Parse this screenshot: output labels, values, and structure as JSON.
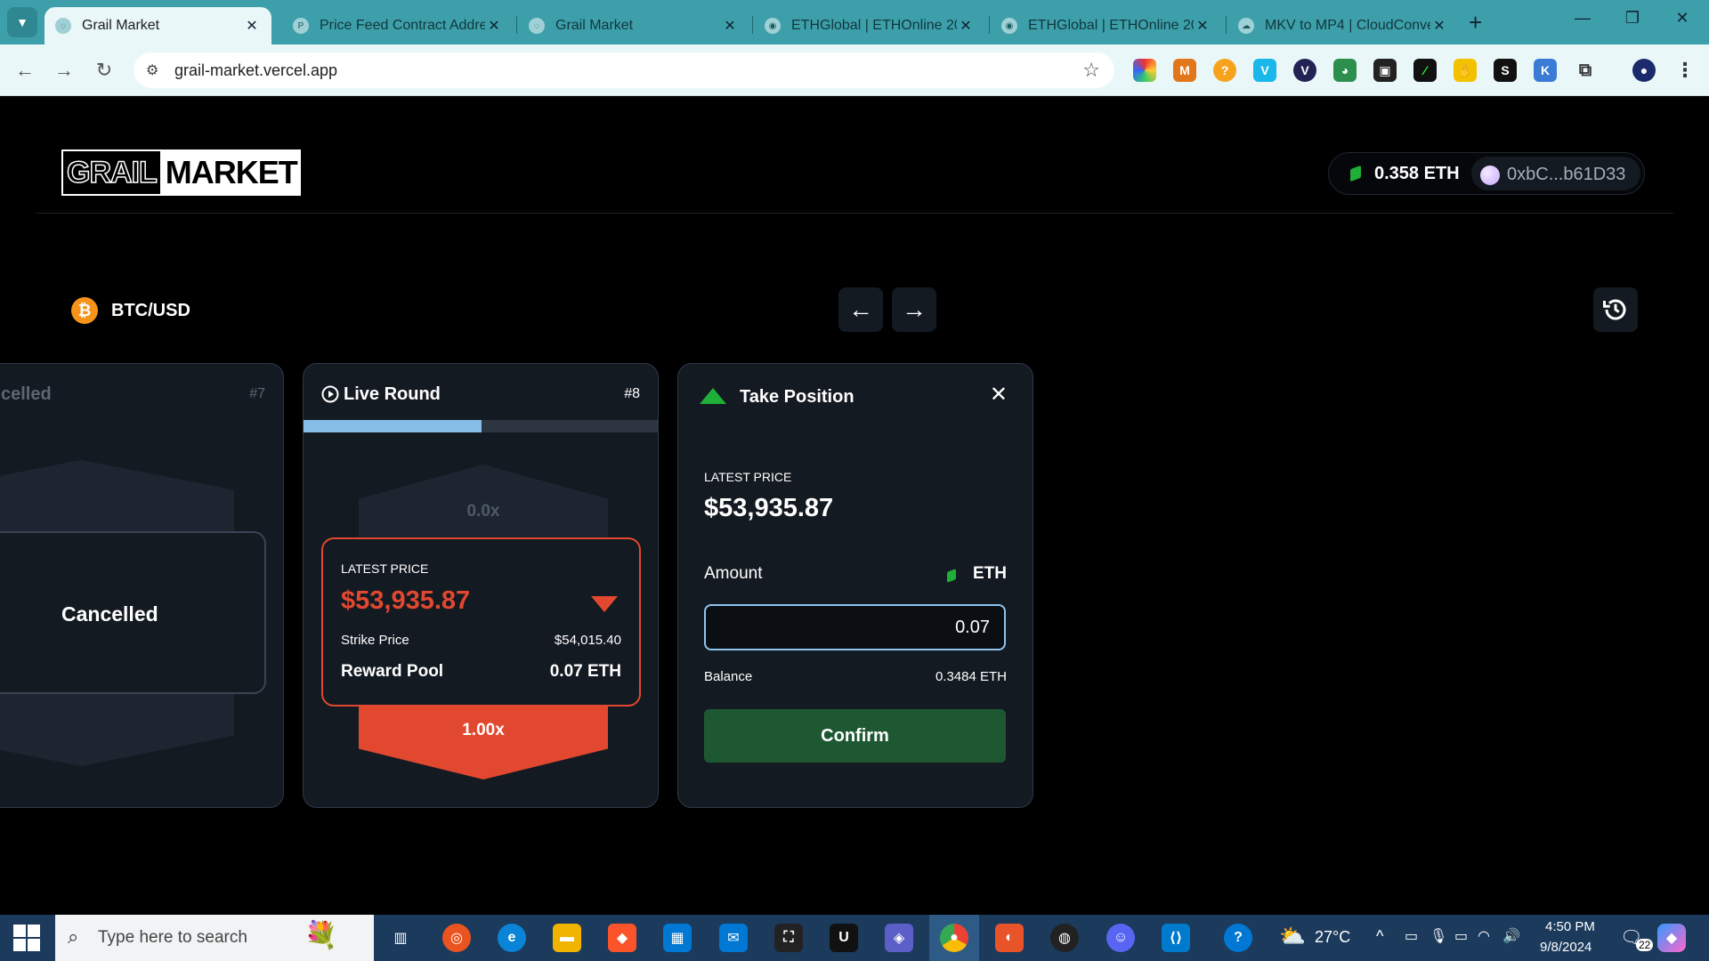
{
  "browser": {
    "tabs": [
      {
        "title": "Grail Market",
        "active": true
      },
      {
        "title": "Price Feed Contract Addre",
        "active": false
      },
      {
        "title": "Grail Market",
        "active": false
      },
      {
        "title": "ETHGlobal | ETHOnline 202",
        "active": false
      },
      {
        "title": "ETHGlobal | ETHOnline 202",
        "active": false
      },
      {
        "title": "MKV to MP4 | CloudConve",
        "active": false
      }
    ],
    "url": "grail-market.vercel.app"
  },
  "header": {
    "logo_part1": "GRAIL",
    "logo_part2": "MARKET",
    "balance": "0.358 ETH",
    "address": "0xbC...b61D33"
  },
  "pair": {
    "symbol": "₿",
    "name": "BTC/USD"
  },
  "cards": {
    "cancelled": {
      "title": "Cancelled",
      "title_visible": "celled",
      "number": "#7",
      "status": "Cancelled"
    },
    "live": {
      "title": "Live Round",
      "number": "#8",
      "progress": 0.5,
      "up_payout": "0.0x",
      "latest_price_label": "LATEST PRICE",
      "latest_price": "$53,935.87",
      "strike_label": "Strike Price",
      "strike_price": "$54,015.40",
      "pool_label": "Reward Pool",
      "pool_value": "0.07 ETH",
      "down_payout": "1.00x"
    },
    "take": {
      "title": "Take Position",
      "latest_price_label": "LATEST PRICE",
      "latest_price": "$53,935.87",
      "amount_label": "Amount",
      "currency": "ETH",
      "amount_value": "0.07",
      "balance_label": "Balance",
      "balance_value": "0.3484 ETH",
      "confirm_label": "Confirm"
    }
  },
  "taskbar": {
    "search_placeholder": "Type here to search",
    "weather": "27°C",
    "time": "4:50 PM",
    "date": "9/8/2024",
    "notifications": "22"
  },
  "colors": {
    "accent_red": "#e2482f",
    "accent_green": "#1fae37",
    "confirm_green": "#1e5832",
    "progress_blue": "#86bde7",
    "card_bg": "#141a22"
  },
  "icons": [
    "tab-search-icon",
    "back-icon",
    "forward-icon",
    "reload-icon",
    "site-info-icon",
    "bookmark-star-icon",
    "eth-icon",
    "bitcoin-icon",
    "arrow-left-icon",
    "arrow-right-icon",
    "history-icon",
    "play-circle-icon",
    "triangle-up-icon",
    "triangle-down-icon",
    "close-icon",
    "windows-icon",
    "search-icon"
  ]
}
